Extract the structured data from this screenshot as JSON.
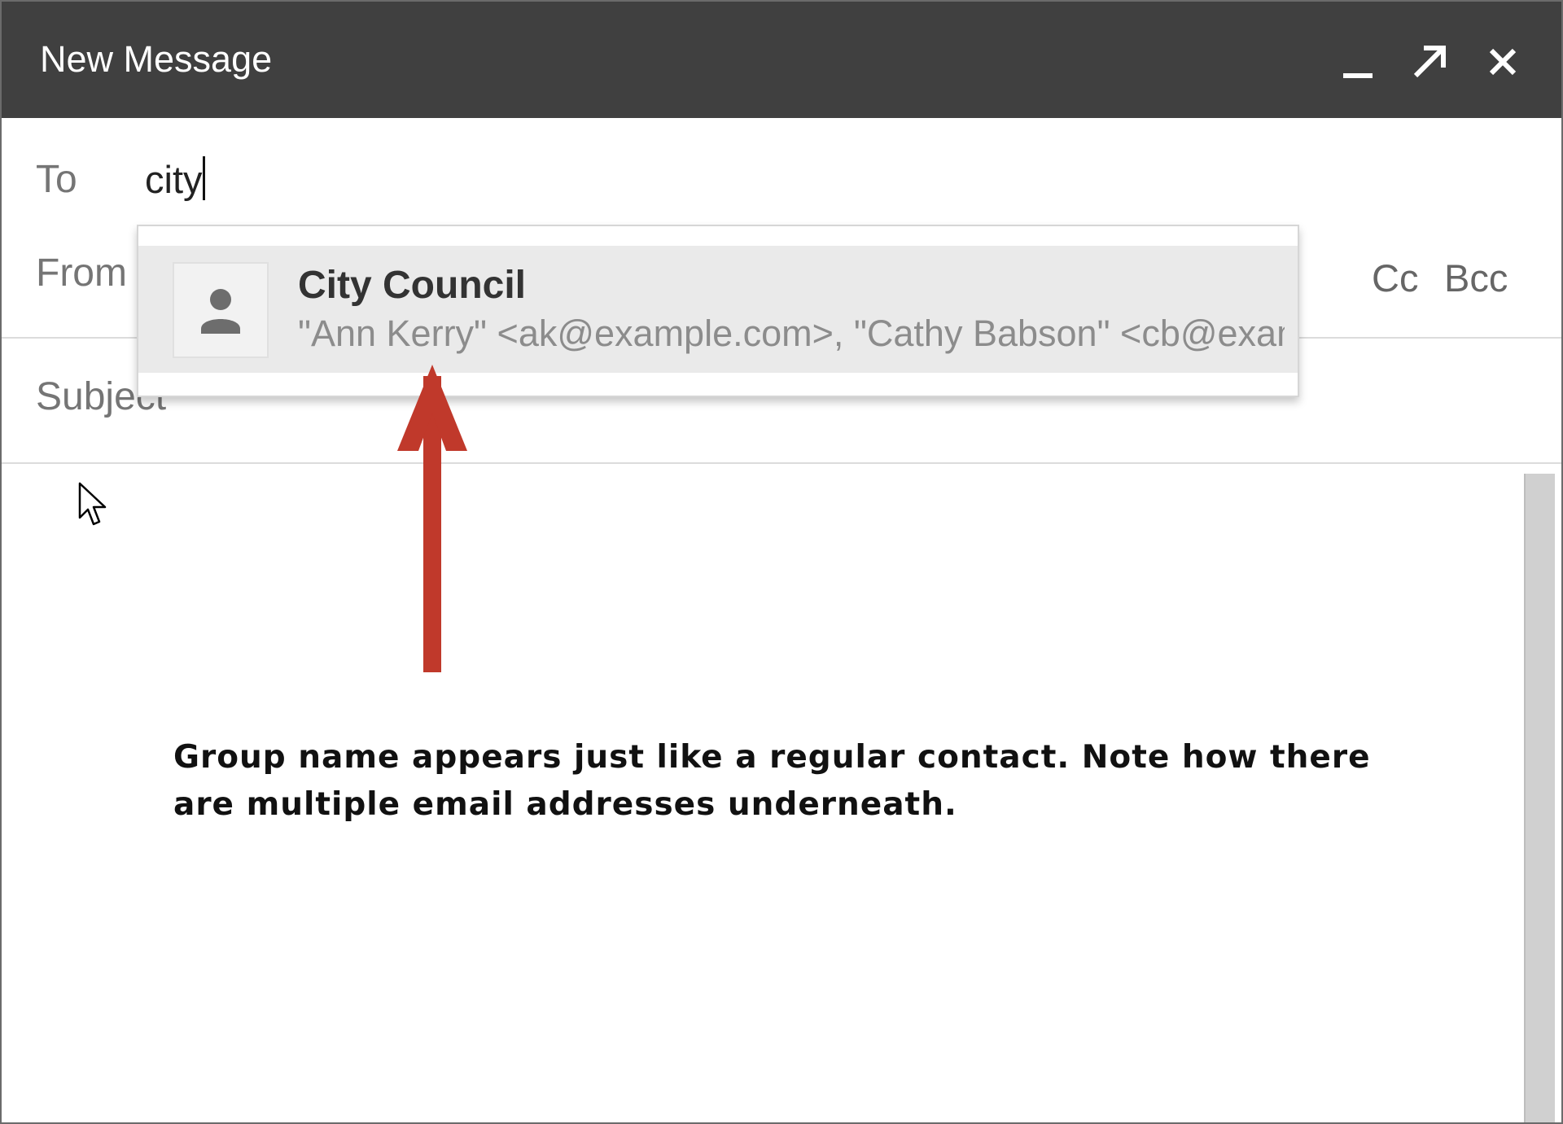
{
  "window": {
    "title": "New Message",
    "controls": {
      "minimize_icon": "minimize-icon",
      "popout_icon": "pop-out-arrow-icon",
      "close_icon": "close-icon"
    }
  },
  "compose": {
    "to_label": "To",
    "to_value": "city",
    "from_label": "From",
    "cc_label": "Cc",
    "bcc_label": "Bcc",
    "subject_label": "Subject"
  },
  "autocomplete": {
    "suggestions": [
      {
        "name": "City Council",
        "emails": "\"Ann Kerry\" <ak@example.com>, \"Cathy Babson\" <cb@example.com>",
        "icon": "person-icon"
      }
    ]
  },
  "annotation": {
    "text": "Group name appears just like a regular contact. Note how there are multiple email addresses underneath.",
    "arrow_color": "#c0392b"
  },
  "colors": {
    "titlebar": "#404040",
    "suggestion_highlight": "#eaeaea"
  }
}
